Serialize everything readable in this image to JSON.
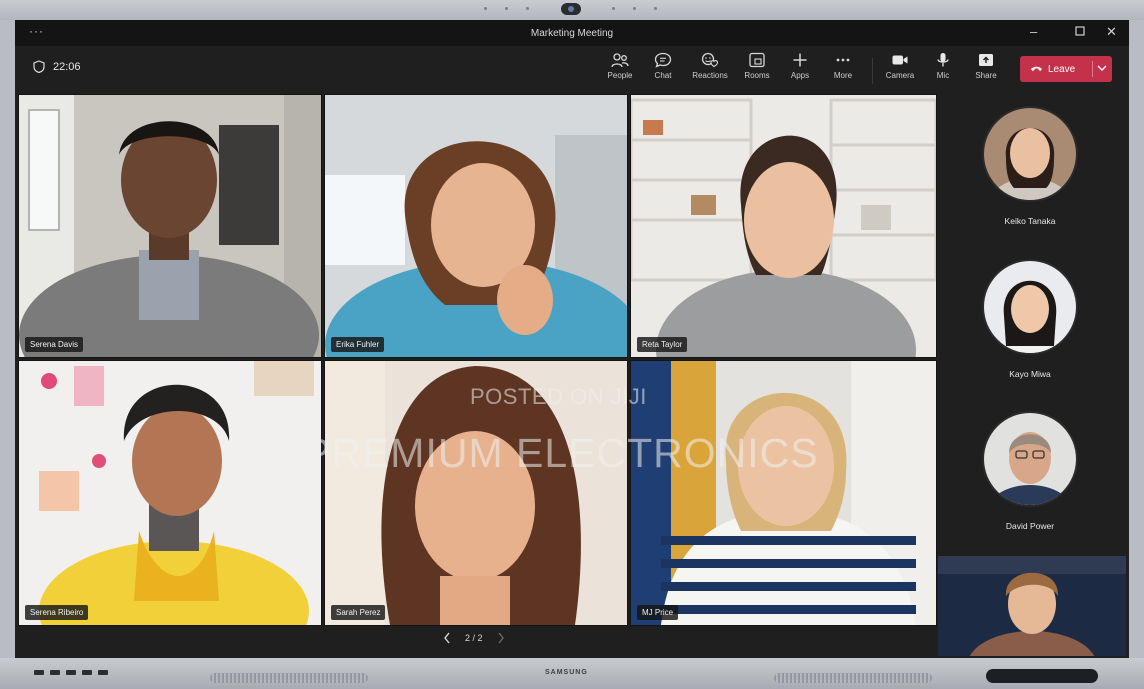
{
  "window": {
    "title": "Marketing Meeting"
  },
  "toolbar": {
    "timer": "22:06",
    "buttons": [
      {
        "id": "people",
        "label": "People"
      },
      {
        "id": "chat",
        "label": "Chat"
      },
      {
        "id": "reactions",
        "label": "Reactions"
      },
      {
        "id": "rooms",
        "label": "Rooms"
      },
      {
        "id": "apps",
        "label": "Apps"
      },
      {
        "id": "more",
        "label": "More"
      },
      {
        "id": "camera",
        "label": "Camera"
      },
      {
        "id": "mic",
        "label": "Mic"
      },
      {
        "id": "share",
        "label": "Share"
      }
    ],
    "leave_label": "Leave"
  },
  "grid": {
    "tiles": [
      {
        "name": "Serena Davis"
      },
      {
        "name": "Erika Fuhler"
      },
      {
        "name": "Reta Taylor"
      },
      {
        "name": "Serena Ribeiro"
      },
      {
        "name": "Sarah Perez"
      },
      {
        "name": "MJ Price"
      }
    ]
  },
  "pager": {
    "text": "2 / 2"
  },
  "side": {
    "participants": [
      {
        "name": "Keiko Tanaka"
      },
      {
        "name": "Kayo Miwa"
      },
      {
        "name": "David Power"
      }
    ]
  },
  "watermark": {
    "line1": "POSTED ON JIJI",
    "line2": "PREMIUM ELECTRONICS"
  },
  "device": {
    "brand": "SAMSUNG"
  },
  "colors": {
    "leave": "#c4314b",
    "background": "#1f1f1f",
    "titlebar": "#141414"
  }
}
